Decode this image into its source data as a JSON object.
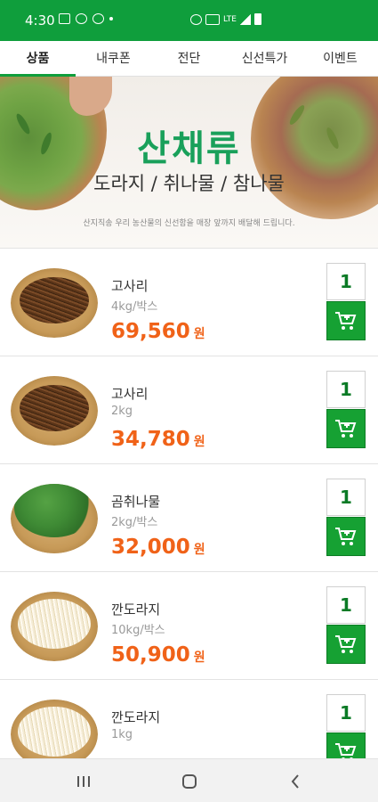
{
  "status_bar": {
    "time": "4:30",
    "network": "LTE",
    "color": "#0f9e3c"
  },
  "tabs": [
    {
      "label": "상품",
      "active": true
    },
    {
      "label": "내쿠폰",
      "active": false
    },
    {
      "label": "전단",
      "active": false
    },
    {
      "label": "신선특가",
      "active": false
    },
    {
      "label": "이벤트",
      "active": false
    }
  ],
  "banner": {
    "title": "산채류",
    "subtitle": "도라지 / 취나물 / 참나물",
    "note": "산지직송 우리 농산물의 신선함을 매장 앞까지 배달해 드립니다."
  },
  "products": [
    {
      "name": "고사리",
      "size": "4kg/박스",
      "price": "69,560",
      "currency": "원",
      "qty": "1",
      "image": "fern-basket"
    },
    {
      "name": "고사리",
      "size": "2kg",
      "price": "34,780",
      "currency": "원",
      "qty": "1",
      "image": "fern-basket"
    },
    {
      "name": "곰취나물",
      "size": "2kg/박스",
      "price": "32,000",
      "currency": "원",
      "qty": "1",
      "image": "gomchwi-leaves"
    },
    {
      "name": "깐도라지",
      "size": "10kg/박스",
      "price": "50,900",
      "currency": "원",
      "qty": "1",
      "image": "peeled-bellflower-root"
    },
    {
      "name": "깐도라지",
      "size": "1kg",
      "price": "",
      "currency": "",
      "qty": "1",
      "image": "peeled-bellflower-root"
    }
  ],
  "colors": {
    "accent": "#0f9e3c",
    "price": "#f06218",
    "cart_button": "#16a133",
    "qty_text": "#0a7a25"
  },
  "nav": {
    "icons": [
      "recent-apps-icon",
      "home-icon",
      "back-icon"
    ]
  }
}
